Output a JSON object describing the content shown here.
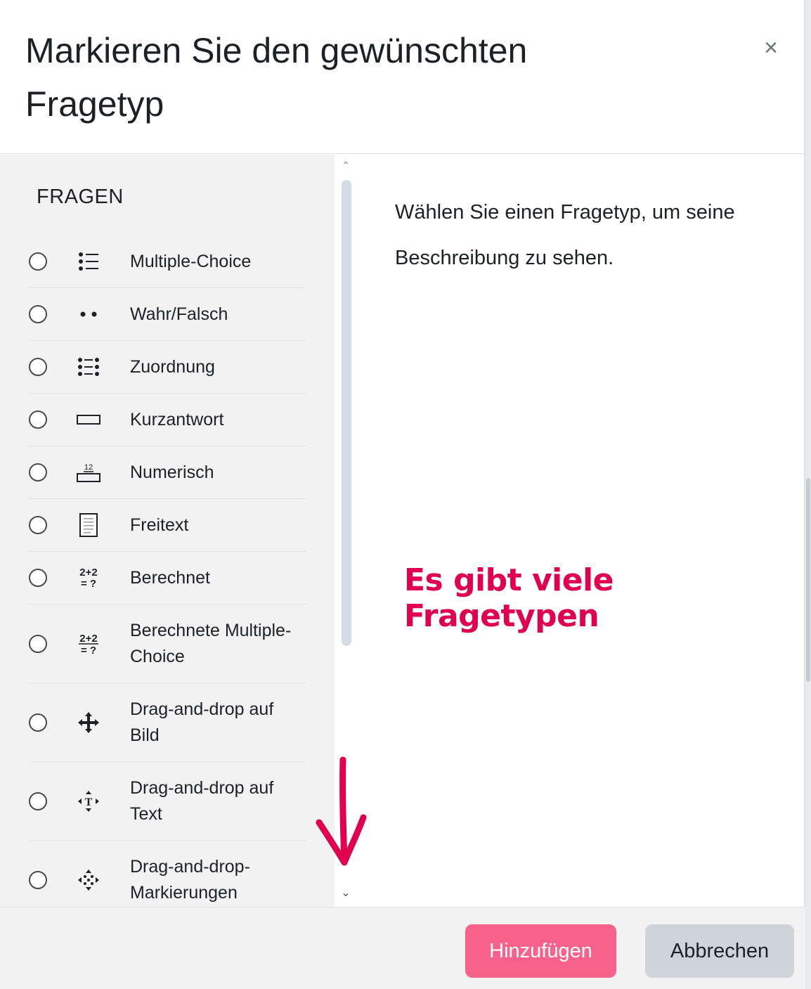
{
  "dialog": {
    "title": "Markieren Sie den gewünschten Fragetyp",
    "close_symbol": "×"
  },
  "sidebar": {
    "section_title": "FRAGEN",
    "items": [
      {
        "label": "Multiple-Choice",
        "icon": "list-icon"
      },
      {
        "label": "Wahr/Falsch",
        "icon": "two-dots-icon"
      },
      {
        "label": "Zuordnung",
        "icon": "matching-icon"
      },
      {
        "label": "Kurzantwort",
        "icon": "short-answer-icon"
      },
      {
        "label": "Numerisch",
        "icon": "numerical-icon",
        "icon_text": "12"
      },
      {
        "label": "Freitext",
        "icon": "essay-icon"
      },
      {
        "label": "Berechnet",
        "icon": "calculated-icon",
        "icon_text_top": "2+2",
        "icon_text_bottom": "= ?"
      },
      {
        "label": "Berechnete Multiple-Choice",
        "icon": "calculated-multichoice-icon",
        "icon_text_top": "2+2",
        "icon_text_bottom": "= ?"
      },
      {
        "label": "Drag-and-drop auf Bild",
        "icon": "move-arrows-icon"
      },
      {
        "label": "Drag-and-drop auf Text",
        "icon": "drag-text-icon"
      },
      {
        "label": "Drag-and-drop-Markierungen",
        "icon": "drag-markers-icon"
      }
    ]
  },
  "main": {
    "description": "Wählen Sie einen Fragetyp, um seine Beschreibung zu sehen.",
    "annotation": "Es gibt viele Fragetypen",
    "annotation_color": "#e0004d"
  },
  "footer": {
    "add_label": "Hinzufügen",
    "cancel_label": "Abbrechen",
    "add_color": "#f7618a"
  }
}
